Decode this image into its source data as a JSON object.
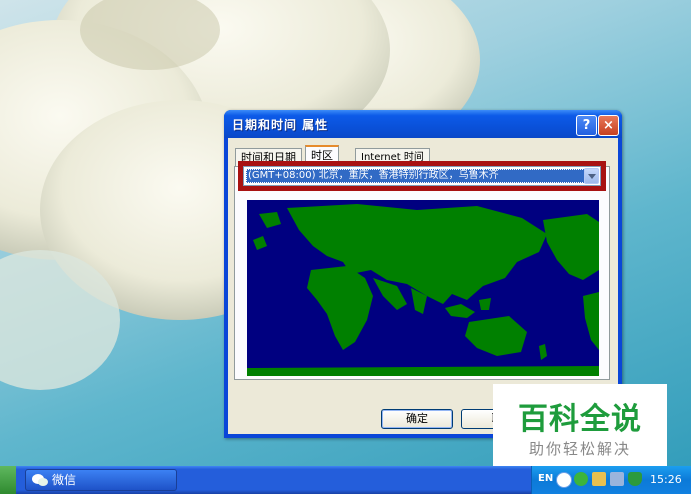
{
  "dialog": {
    "title": "日期和时间 属性",
    "help_glyph": "?",
    "close_glyph": "×",
    "tabs": [
      {
        "label": "时间和日期"
      },
      {
        "label": "时区"
      },
      {
        "label": "Internet 时间"
      }
    ],
    "active_tab": "时区",
    "timezone_value": "(GMT+08:00) 北京，重庆，香港特别行政区，乌鲁木齐",
    "ok_label": "确定",
    "cancel_label": "取"
  },
  "watermark": {
    "main": "百科全说",
    "sub": "助你轻松解决"
  },
  "taskbar": {
    "wechat_label": "微信",
    "language": "EN",
    "clock": "15:26"
  },
  "colors": {
    "map_ocean": "#000080",
    "map_land": "#008000",
    "highlight_border": "#a81212",
    "watermark_green": "#1e9c3c"
  },
  "icons": [
    "help-icon",
    "close-icon",
    "dropdown-arrow-icon",
    "wechat-icon",
    "tray-back-icon",
    "tray-wechat-icon",
    "tray-network-icon",
    "tray-speaker-icon",
    "tray-shield-icon"
  ]
}
